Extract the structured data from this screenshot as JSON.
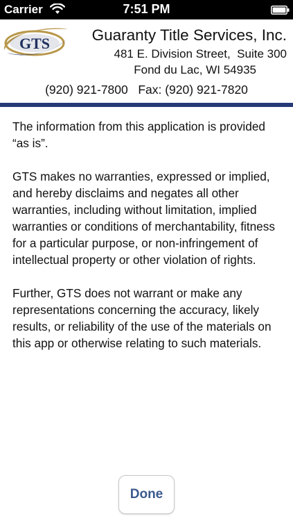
{
  "status_bar": {
    "carrier": "Carrier",
    "time": "7:51 PM",
    "wifi_icon": "wifi-icon",
    "battery_icon": "battery-icon"
  },
  "header": {
    "logo_text": "GTS",
    "company_name": "Guaranty Title Services, Inc.",
    "address": "481 E. Division Street,  Suite 300",
    "city": "Fond du Lac, WI 54935",
    "phone": "(920) 921-7800   Fax: (920) 921-7820"
  },
  "disclaimer": {
    "paragraphs": [
      "The information from this application is provided “as is”.",
      "GTS makes no warranties, expressed or implied, and hereby disclaims and negates all other warranties, including without limitation, implied warranties or conditions of merchantability, fitness for a particular purpose, or non-infringement of intellectual property or other violation of rights.",
      "Further, GTS does not warrant or make any representations concerning the accuracy, likely results, or reliability of the use of the materials on this app or otherwise relating to such materials."
    ]
  },
  "footer": {
    "done_label": "Done"
  },
  "colors": {
    "divider": "#263a78",
    "logo_gold": "#b8974a",
    "logo_navy": "#1f2f5c",
    "button_text": "#3b5a8e"
  }
}
